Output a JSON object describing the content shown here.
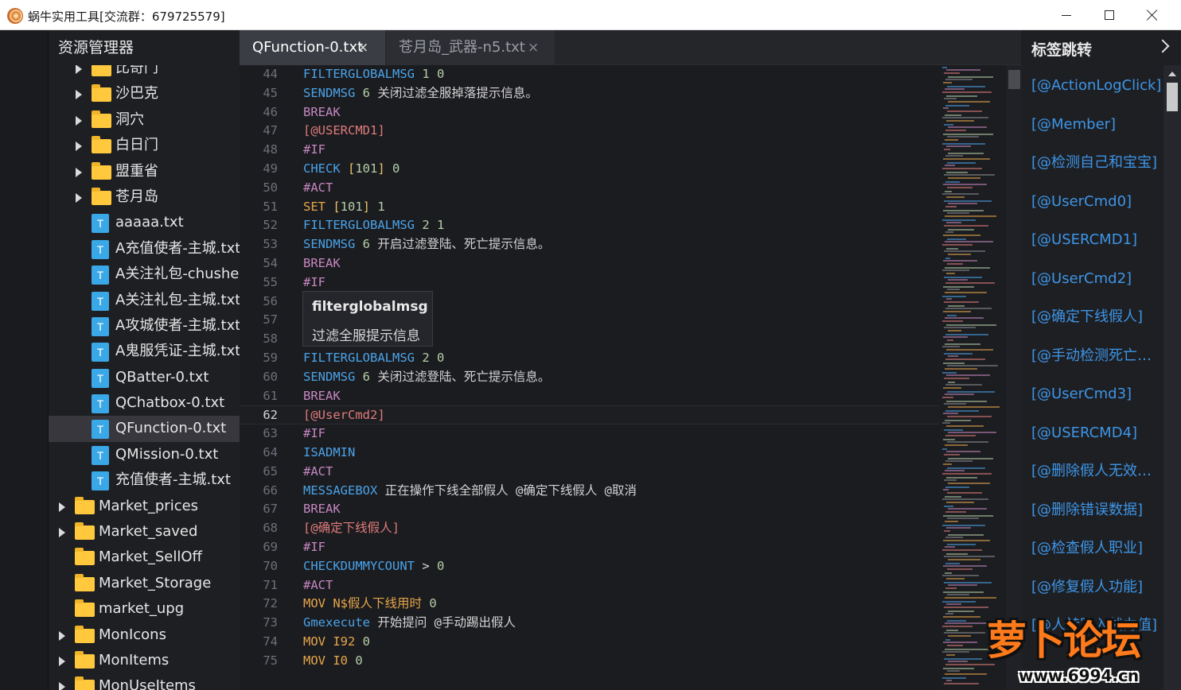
{
  "window": {
    "title": "蜗牛实用工具[交流群：679725579]",
    "icon": "snail-icon"
  },
  "explorer": {
    "title": "资源管理器",
    "items": [
      {
        "label": "比奇门",
        "type": "folder",
        "level": 1,
        "expandable": true
      },
      {
        "label": "沙巴克",
        "type": "folder",
        "level": 1,
        "expandable": true
      },
      {
        "label": "洞穴",
        "type": "folder",
        "level": 1,
        "expandable": true
      },
      {
        "label": "白日门",
        "type": "folder",
        "level": 1,
        "expandable": true
      },
      {
        "label": "盟重省",
        "type": "folder",
        "level": 1,
        "expandable": true
      },
      {
        "label": "苍月岛",
        "type": "folder",
        "level": 1,
        "expandable": true
      },
      {
        "label": "aaaaa.txt",
        "type": "file",
        "level": 1
      },
      {
        "label": "A充值使者-主城.txt",
        "type": "file",
        "level": 1
      },
      {
        "label": "A关注礼包-chusheng",
        "type": "file",
        "level": 1
      },
      {
        "label": "A关注礼包-主城.txt",
        "type": "file",
        "level": 1
      },
      {
        "label": "A攻城使者-主城.txt",
        "type": "file",
        "level": 1
      },
      {
        "label": "A鬼服凭证-主城.txt",
        "type": "file",
        "level": 1
      },
      {
        "label": "QBatter-0.txt",
        "type": "file",
        "level": 1
      },
      {
        "label": "QChatbox-0.txt",
        "type": "file",
        "level": 1
      },
      {
        "label": "QFunction-0.txt",
        "type": "file",
        "level": 1,
        "selected": true
      },
      {
        "label": "QMission-0.txt",
        "type": "file",
        "level": 1
      },
      {
        "label": "充值使者-主城.txt",
        "type": "file",
        "level": 1
      },
      {
        "label": "Market_prices",
        "type": "folder",
        "level": 0,
        "expandable": true
      },
      {
        "label": "Market_saved",
        "type": "folder",
        "level": 0,
        "expandable": true
      },
      {
        "label": "Market_SellOff",
        "type": "folder",
        "level": 0,
        "expandable": false
      },
      {
        "label": "Market_Storage",
        "type": "folder",
        "level": 0,
        "expandable": false
      },
      {
        "label": "market_upg",
        "type": "folder",
        "level": 0,
        "expandable": false
      },
      {
        "label": "MonIcons",
        "type": "folder",
        "level": 0,
        "expandable": true
      },
      {
        "label": "MonItems",
        "type": "folder",
        "level": 0,
        "expandable": true
      },
      {
        "label": "MonUseItems",
        "type": "folder",
        "level": 0,
        "expandable": true
      }
    ],
    "file_icon_letter": "T"
  },
  "tabs": [
    {
      "label": "QFunction-0.txt",
      "active": true,
      "close": "×"
    },
    {
      "label": "苍月岛_武器-n5.txt",
      "active": false,
      "close": "×"
    }
  ],
  "editor": {
    "current_line": 62,
    "lines": [
      {
        "n": 44,
        "tokens": [
          {
            "t": "FILTERGLOBALMSG",
            "c": "kw-cmd"
          },
          {
            "t": " 1 0",
            "c": "kw-num"
          }
        ]
      },
      {
        "n": 45,
        "tokens": [
          {
            "t": "SENDMSG",
            "c": "kw-cmd"
          },
          {
            "t": " 6 ",
            "c": "kw-num"
          },
          {
            "t": "关闭过滤全服掉落提示信息。",
            "c": "txt"
          }
        ]
      },
      {
        "n": 46,
        "tokens": [
          {
            "t": "BREAK",
            "c": "kw-dir"
          }
        ]
      },
      {
        "n": 47,
        "tokens": [
          {
            "t": "[@USERCMD1]",
            "c": "kw-label"
          }
        ]
      },
      {
        "n": 48,
        "tokens": [
          {
            "t": "#IF",
            "c": "kw-dir"
          }
        ]
      },
      {
        "n": 49,
        "tokens": [
          {
            "t": "CHECK",
            "c": "kw-cmd"
          },
          {
            "t": " [",
            "c": "kw-br"
          },
          {
            "t": "101",
            "c": "kw-num"
          },
          {
            "t": "]",
            "c": "kw-br"
          },
          {
            "t": " 0",
            "c": "kw-num"
          }
        ]
      },
      {
        "n": 50,
        "tokens": [
          {
            "t": "#ACT",
            "c": "kw-dir"
          }
        ]
      },
      {
        "n": 51,
        "tokens": [
          {
            "t": "SET",
            "c": "kw-set"
          },
          {
            "t": " [",
            "c": "kw-br"
          },
          {
            "t": "101",
            "c": "kw-num"
          },
          {
            "t": "]",
            "c": "kw-br"
          },
          {
            "t": " 1",
            "c": "kw-num"
          }
        ]
      },
      {
        "n": 52,
        "tokens": [
          {
            "t": "FILTERGLOBALMSG",
            "c": "kw-cmd"
          },
          {
            "t": " 2 1",
            "c": "kw-num"
          }
        ]
      },
      {
        "n": 53,
        "tokens": [
          {
            "t": "SENDMSG",
            "c": "kw-cmd"
          },
          {
            "t": " 6 ",
            "c": "kw-num"
          },
          {
            "t": "开启过滤登陆、死亡提示信息。",
            "c": "txt"
          }
        ]
      },
      {
        "n": 54,
        "tokens": [
          {
            "t": "BREAK",
            "c": "kw-dir"
          }
        ]
      },
      {
        "n": 55,
        "tokens": [
          {
            "t": "#IF",
            "c": "kw-dir"
          }
        ]
      },
      {
        "n": 56,
        "tokens": []
      },
      {
        "n": 57,
        "tokens": []
      },
      {
        "n": 58,
        "tokens": []
      },
      {
        "n": 59,
        "tokens": [
          {
            "t": "FILTERGLOBALMSG",
            "c": "kw-cmd"
          },
          {
            "t": " 2 0",
            "c": "kw-num"
          }
        ]
      },
      {
        "n": 60,
        "tokens": [
          {
            "t": "SENDMSG",
            "c": "kw-cmd"
          },
          {
            "t": " 6 ",
            "c": "kw-num"
          },
          {
            "t": "关闭过滤登陆、死亡提示信息。",
            "c": "txt"
          }
        ]
      },
      {
        "n": 61,
        "tokens": [
          {
            "t": "BREAK",
            "c": "kw-dir"
          }
        ]
      },
      {
        "n": 62,
        "tokens": [
          {
            "t": "[@UserCmd2]",
            "c": "kw-label"
          }
        ]
      },
      {
        "n": 63,
        "tokens": [
          {
            "t": "#IF",
            "c": "kw-dir"
          }
        ]
      },
      {
        "n": 64,
        "tokens": [
          {
            "t": "ISADMIN",
            "c": "kw-cmd"
          }
        ]
      },
      {
        "n": 65,
        "tokens": [
          {
            "t": "#ACT",
            "c": "kw-dir"
          }
        ]
      },
      {
        "n": 66,
        "tokens": [
          {
            "t": "MESSAGEBOX",
            "c": "kw-cmd"
          },
          {
            "t": " 正在操作下线全部假人 @确定下线假人 @取消",
            "c": "txt"
          }
        ]
      },
      {
        "n": 67,
        "tokens": [
          {
            "t": "BREAK",
            "c": "kw-dir"
          }
        ]
      },
      {
        "n": 68,
        "tokens": [
          {
            "t": "[@确定下线假人]",
            "c": "kw-label"
          }
        ]
      },
      {
        "n": 69,
        "tokens": [
          {
            "t": "#IF",
            "c": "kw-dir"
          }
        ]
      },
      {
        "n": 70,
        "tokens": [
          {
            "t": "CHECKDUMMYCOUNT",
            "c": "kw-cmd"
          },
          {
            "t": " > ",
            "c": "txt"
          },
          {
            "t": "0",
            "c": "kw-num"
          }
        ]
      },
      {
        "n": 71,
        "tokens": [
          {
            "t": "#ACT",
            "c": "kw-dir"
          }
        ]
      },
      {
        "n": 72,
        "tokens": [
          {
            "t": "MOV",
            "c": "kw-set"
          },
          {
            "t": " N$假人下线用时",
            "c": "kw-set"
          },
          {
            "t": " 0",
            "c": "kw-num"
          }
        ]
      },
      {
        "n": 73,
        "tokens": [
          {
            "t": "Gmexecute",
            "c": "kw-cmd"
          },
          {
            "t": " 开始提问 @手动踢出假人",
            "c": "txt"
          }
        ]
      },
      {
        "n": 74,
        "tokens": [
          {
            "t": "MOV",
            "c": "kw-set"
          },
          {
            "t": " I92",
            "c": "kw-set"
          },
          {
            "t": " 0",
            "c": "kw-num"
          }
        ]
      },
      {
        "n": 75,
        "tokens": [
          {
            "t": "MOV",
            "c": "kw-set"
          },
          {
            "t": " I0",
            "c": "kw-set"
          },
          {
            "t": " 0",
            "c": "kw-num"
          }
        ]
      }
    ]
  },
  "hover_tooltip": {
    "title": "filterglobalmsg",
    "description": "过滤全服提示信息"
  },
  "bookmarks": {
    "title": "标签跳转",
    "items": [
      "[@ActionLogClick]",
      "[@Member]",
      "[@检测自己和宝宝]",
      "[@UserCmd0]",
      "[@USERCMD1]",
      "[@UserCmd2]",
      "[@确定下线假人]",
      "[@手动检测死亡假人]",
      "[@UserCmd3]",
      "[@USERCMD4]",
      "[@删除假人无效数据]",
      "[@删除错误数据]",
      "[@检查假人职业]",
      "[@修复假人功能]",
      "[@人转写入战力值]"
    ]
  },
  "watermark": {
    "text": "萝卜论坛",
    "url": "www.6994.cn"
  },
  "colors": {
    "accent_link": "#3d95e6",
    "command": "#4aa3e8",
    "directive": "#c586c0",
    "label": "#e07b7b",
    "folder": "#ffc83d",
    "file_icon": "#3aa7e6"
  }
}
